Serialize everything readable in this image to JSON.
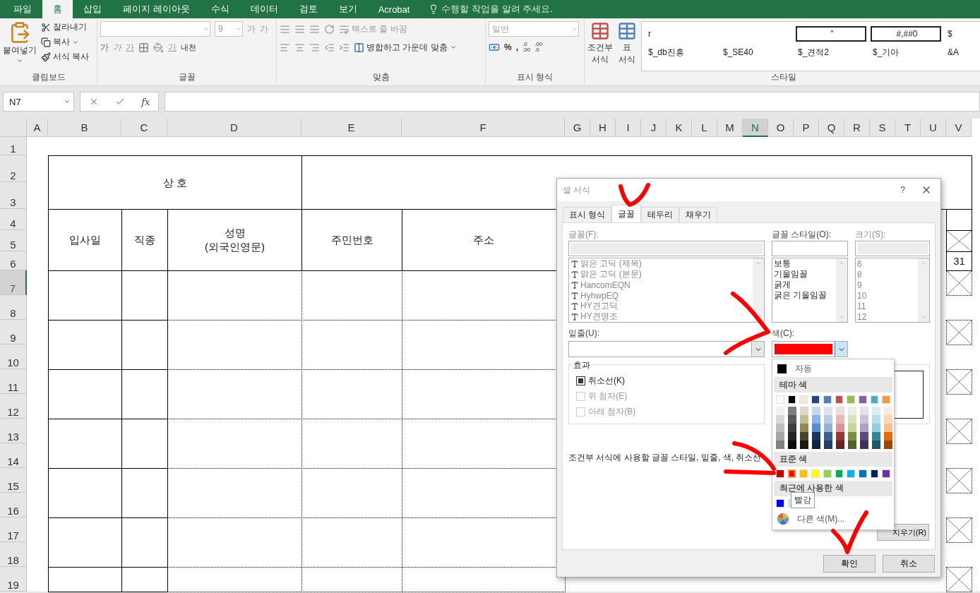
{
  "ribbon_tabs": [
    {
      "label": "파일",
      "selected": false
    },
    {
      "label": "홈",
      "selected": true
    },
    {
      "label": "삽입",
      "selected": false
    },
    {
      "label": "페이지 레이아웃",
      "selected": false
    },
    {
      "label": "수식",
      "selected": false
    },
    {
      "label": "데이터",
      "selected": false
    },
    {
      "label": "검토",
      "selected": false
    },
    {
      "label": "보기",
      "selected": false
    },
    {
      "label": "Acrobat",
      "selected": false
    }
  ],
  "tell_me": "수행할 작업을 알려 주세요.",
  "clipboard": {
    "paste": "붙여넣기",
    "cut": "잘라내기",
    "copy": "복사",
    "format_painter": "서식 복사",
    "label": "클립보드"
  },
  "font": {
    "size": "9",
    "grow": "가",
    "shrink": "가",
    "bold": "가",
    "italic": "가",
    "underline": "가",
    "font_color": "가",
    "phonetic": "내천",
    "label": "글꼴"
  },
  "alignment": {
    "wrap_text": "텍스트 줄 바꿈",
    "merge_center": "병합하고 가운데 맞춤",
    "label": "맞춤"
  },
  "number": {
    "format": "일반",
    "percent": "%",
    "comma": ",",
    "increase_decimal": [
      ".0",
      ".00"
    ],
    "decrease_decimal": [
      ".00",
      ".0"
    ],
    "label": "표시 형식"
  },
  "styles": {
    "conditional": [
      "조건부",
      "서식"
    ],
    "table": [
      "표",
      "서식"
    ],
    "label": "스타일",
    "gallery": [
      {
        "text": "r",
        "boxed": false
      },
      {
        "text": "\"",
        "boxed": true
      },
      {
        "text": "#,##0",
        "boxed": true
      },
      {
        "text": "$",
        "boxed": false
      },
      {
        "text": "$_db진흥",
        "boxed": false
      },
      {
        "text": "$_SE40",
        "boxed": false
      },
      {
        "text": "$_견적2",
        "boxed": false
      },
      {
        "text": "$_기아",
        "boxed": false
      },
      {
        "text": "&A",
        "boxed": false
      }
    ]
  },
  "formula_bar": {
    "name_box": "N7",
    "function": "fx"
  },
  "sheet": {
    "columns": [
      {
        "label": "A",
        "selected": false
      },
      {
        "label": "B",
        "selected": false
      },
      {
        "label": "C",
        "selected": false
      },
      {
        "label": "D",
        "selected": false
      },
      {
        "label": "E",
        "selected": false
      },
      {
        "label": "F",
        "selected": false
      },
      {
        "label": "G",
        "selected": false
      },
      {
        "label": "H",
        "selected": false
      },
      {
        "label": "I",
        "selected": false
      },
      {
        "label": "J",
        "selected": false
      },
      {
        "label": "K",
        "selected": false
      },
      {
        "label": "L",
        "selected": false
      },
      {
        "label": "M",
        "selected": false
      },
      {
        "label": "N",
        "selected": true
      },
      {
        "label": "O",
        "selected": false
      },
      {
        "label": "P",
        "selected": false
      },
      {
        "label": "Q",
        "selected": false
      },
      {
        "label": "R",
        "selected": false
      },
      {
        "label": "S",
        "selected": false
      },
      {
        "label": "T",
        "selected": false
      },
      {
        "label": "U",
        "selected": false
      },
      {
        "label": "V",
        "selected": false
      }
    ],
    "rows": [
      {
        "label": "1",
        "selected": false
      },
      {
        "label": "2",
        "selected": false
      },
      {
        "label": "3",
        "selected": false
      },
      {
        "label": "4",
        "selected": false
      },
      {
        "label": "5",
        "selected": false
      },
      {
        "label": "6",
        "selected": false
      },
      {
        "label": "7",
        "selected": true
      },
      {
        "label": "8",
        "selected": false
      },
      {
        "label": "9",
        "selected": false
      },
      {
        "label": "10",
        "selected": false
      },
      {
        "label": "11",
        "selected": false
      },
      {
        "label": "12",
        "selected": false
      },
      {
        "label": "13",
        "selected": false
      },
      {
        "label": "14",
        "selected": false
      },
      {
        "label": "15",
        "selected": false
      },
      {
        "label": "16",
        "selected": false
      },
      {
        "label": "17",
        "selected": false
      },
      {
        "label": "18",
        "selected": false
      },
      {
        "label": "19",
        "selected": false
      }
    ],
    "company_label": "상   호",
    "headers": [
      "입사일",
      "직종",
      "성명\n(외국인영문)",
      "주민번호",
      "주소"
    ],
    "side_number": "31"
  },
  "dialog": {
    "title": "셀 서식",
    "help": "?",
    "tabs": [
      {
        "label": "표시 형식",
        "selected": false
      },
      {
        "label": "글꼴",
        "selected": true
      },
      {
        "label": "테두리",
        "selected": false
      },
      {
        "label": "채우기",
        "selected": false
      }
    ],
    "font_label": "글꼴(F):",
    "fonts": [
      "맑은 고딕 (제목)",
      "맑은 고딕 (본문)",
      "HancomEQN",
      "HyhwpEQ",
      "HY견고딕",
      "HY견명조"
    ],
    "style_label": "글꼴 스타일(O):",
    "font_styles": [
      "보통",
      "기울임꼴",
      "굵게",
      "굵은 기울임꼴"
    ],
    "size_label": "크기(S):",
    "sizes": [
      "6",
      "8",
      "9",
      "10",
      "11",
      "12"
    ],
    "underline_label": "밑줄(U):",
    "color_label": "색(C):",
    "color": "#ff0000",
    "effects_label": "효과",
    "effects": [
      {
        "label": "취소선(K)",
        "checked": true,
        "disabled": false
      },
      {
        "label": "위 첨자(E)",
        "checked": false,
        "disabled": true
      },
      {
        "label": "아래 첨자(B)",
        "checked": false,
        "disabled": true
      }
    ],
    "note": "조건부 서식에 사용할 글꼴 스타일, 밑줄, 색, 취소선",
    "clear": "지우기(R)",
    "ok": "확인",
    "cancel": "취소",
    "color_menu": {
      "automatic": "자동",
      "theme_label": "테마 색",
      "theme": [
        {
          "color": "#ffffff",
          "shades": [
            {
              "color": "#f2f2f2"
            },
            {
              "color": "#d9d9d9"
            },
            {
              "color": "#bfbfbf"
            },
            {
              "color": "#a6a6a6"
            },
            {
              "color": "#808080"
            }
          ]
        },
        {
          "color": "#000000",
          "shades": [
            {
              "color": "#7f7f7f"
            },
            {
              "color": "#595959"
            },
            {
              "color": "#3f3f3f"
            },
            {
              "color": "#262626"
            },
            {
              "color": "#0d0d0d"
            }
          ]
        },
        {
          "color": "#eeece1",
          "shades": [
            {
              "color": "#ddd9c3"
            },
            {
              "color": "#c4bd97"
            },
            {
              "color": "#938953"
            },
            {
              "color": "#494429"
            },
            {
              "color": "#1d1b10"
            }
          ]
        },
        {
          "color": "#1f497d",
          "shades": [
            {
              "color": "#c6d9f0"
            },
            {
              "color": "#8db3e2"
            },
            {
              "color": "#548dd4"
            },
            {
              "color": "#17365d"
            },
            {
              "color": "#0f243e"
            }
          ]
        },
        {
          "color": "#4f81bd",
          "shades": [
            {
              "color": "#dbe5f1"
            },
            {
              "color": "#b8cce4"
            },
            {
              "color": "#95b3d7"
            },
            {
              "color": "#366092"
            },
            {
              "color": "#244061"
            }
          ]
        },
        {
          "color": "#c0504d",
          "shades": [
            {
              "color": "#f2dcdb"
            },
            {
              "color": "#e5b9b7"
            },
            {
              "color": "#d99694"
            },
            {
              "color": "#953734"
            },
            {
              "color": "#632423"
            }
          ]
        },
        {
          "color": "#9bbb59",
          "shades": [
            {
              "color": "#ebf1dd"
            },
            {
              "color": "#d7e3bc"
            },
            {
              "color": "#c3d69b"
            },
            {
              "color": "#76923c"
            },
            {
              "color": "#4f6128"
            }
          ]
        },
        {
          "color": "#8064a2",
          "shades": [
            {
              "color": "#e5e0ec"
            },
            {
              "color": "#ccc1d9"
            },
            {
              "color": "#b2a2c7"
            },
            {
              "color": "#5f497a"
            },
            {
              "color": "#3f3151"
            }
          ]
        },
        {
          "color": "#4bacc6",
          "shades": [
            {
              "color": "#dbeef3"
            },
            {
              "color": "#b7dde8"
            },
            {
              "color": "#92cddc"
            },
            {
              "color": "#31859b"
            },
            {
              "color": "#205867"
            }
          ]
        },
        {
          "color": "#f79646",
          "shades": [
            {
              "color": "#fdeada"
            },
            {
              "color": "#fbd5b5"
            },
            {
              "color": "#fac08f"
            },
            {
              "color": "#e36c09"
            },
            {
              "color": "#974806"
            }
          ]
        }
      ],
      "standard_label": "표준 색",
      "standard": [
        {
          "color": "#c00000",
          "selected": false
        },
        {
          "color": "#ff0000",
          "selected": true
        },
        {
          "color": "#ffc000",
          "selected": false
        },
        {
          "color": "#ffff00",
          "selected": false
        },
        {
          "color": "#92d050",
          "selected": false
        },
        {
          "color": "#00b050",
          "selected": false
        },
        {
          "color": "#00b0f0",
          "selected": false
        },
        {
          "color": "#0070c0",
          "selected": false
        },
        {
          "color": "#002060",
          "selected": false
        },
        {
          "color": "#7030a0",
          "selected": false
        }
      ],
      "recent_label": "최근에 사용한 색",
      "recent": [
        {
          "color": "#0000ff"
        },
        {
          "color": "#c6efce"
        }
      ],
      "more": "다른 색(M)...",
      "tooltip": "빨강"
    }
  }
}
